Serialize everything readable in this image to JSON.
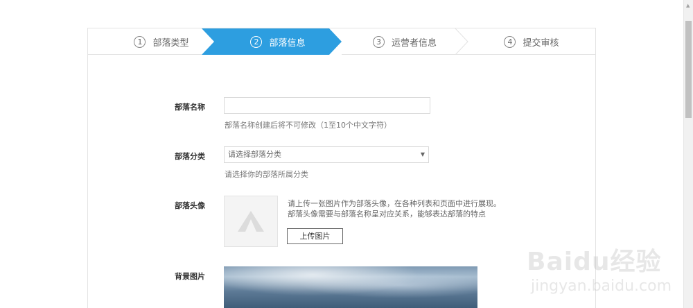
{
  "steps": [
    {
      "num": "1",
      "label": "部落类型"
    },
    {
      "num": "2",
      "label": "部落信息"
    },
    {
      "num": "3",
      "label": "运营者信息"
    },
    {
      "num": "4",
      "label": "提交审核"
    }
  ],
  "colors": {
    "active_step": "#2d9ee0",
    "step_border": "#dddddd"
  },
  "form": {
    "name": {
      "label": "部落名称",
      "value": "",
      "hint": "部落名称创建后将不可修改（1至10个中文字符）"
    },
    "category": {
      "label": "部落分类",
      "selected": "请选择部落分类",
      "hint": "请选择你的部落所属分类"
    },
    "avatar": {
      "label": "部落头像",
      "desc1": "请上传一张图片作为部落头像，在各种列表和页面中进行展现。",
      "desc2": "部落头像需要与部落名称呈对应关系，能够表达部落的特点",
      "upload_label": "上传图片"
    },
    "background": {
      "label": "背景图片"
    }
  },
  "watermark": {
    "brand": "Baidu经验",
    "site": "jingyan.baidu.com"
  }
}
